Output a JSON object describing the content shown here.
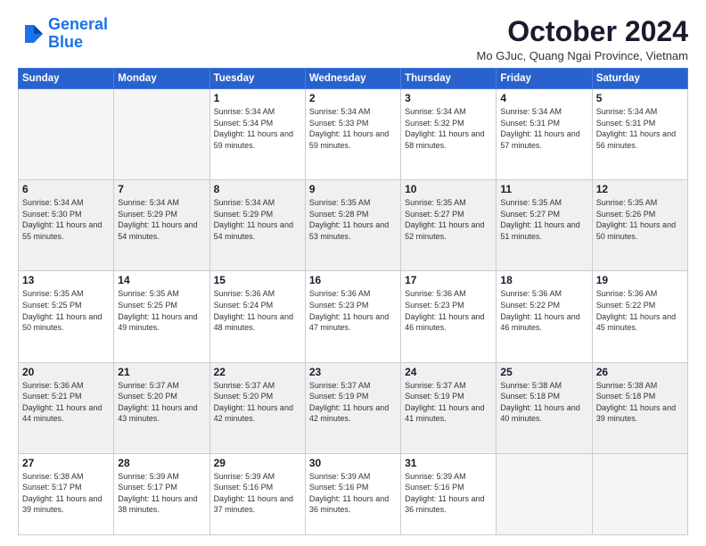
{
  "logo": {
    "line1": "General",
    "line2": "Blue"
  },
  "title": "October 2024",
  "location": "Mo GJuc, Quang Ngai Province, Vietnam",
  "days_of_week": [
    "Sunday",
    "Monday",
    "Tuesday",
    "Wednesday",
    "Thursday",
    "Friday",
    "Saturday"
  ],
  "weeks": [
    [
      {
        "num": "",
        "detail": ""
      },
      {
        "num": "",
        "detail": ""
      },
      {
        "num": "1",
        "detail": "Sunrise: 5:34 AM\nSunset: 5:34 PM\nDaylight: 11 hours and 59 minutes."
      },
      {
        "num": "2",
        "detail": "Sunrise: 5:34 AM\nSunset: 5:33 PM\nDaylight: 11 hours and 59 minutes."
      },
      {
        "num": "3",
        "detail": "Sunrise: 5:34 AM\nSunset: 5:32 PM\nDaylight: 11 hours and 58 minutes."
      },
      {
        "num": "4",
        "detail": "Sunrise: 5:34 AM\nSunset: 5:31 PM\nDaylight: 11 hours and 57 minutes."
      },
      {
        "num": "5",
        "detail": "Sunrise: 5:34 AM\nSunset: 5:31 PM\nDaylight: 11 hours and 56 minutes."
      }
    ],
    [
      {
        "num": "6",
        "detail": "Sunrise: 5:34 AM\nSunset: 5:30 PM\nDaylight: 11 hours and 55 minutes."
      },
      {
        "num": "7",
        "detail": "Sunrise: 5:34 AM\nSunset: 5:29 PM\nDaylight: 11 hours and 54 minutes."
      },
      {
        "num": "8",
        "detail": "Sunrise: 5:34 AM\nSunset: 5:29 PM\nDaylight: 11 hours and 54 minutes."
      },
      {
        "num": "9",
        "detail": "Sunrise: 5:35 AM\nSunset: 5:28 PM\nDaylight: 11 hours and 53 minutes."
      },
      {
        "num": "10",
        "detail": "Sunrise: 5:35 AM\nSunset: 5:27 PM\nDaylight: 11 hours and 52 minutes."
      },
      {
        "num": "11",
        "detail": "Sunrise: 5:35 AM\nSunset: 5:27 PM\nDaylight: 11 hours and 51 minutes."
      },
      {
        "num": "12",
        "detail": "Sunrise: 5:35 AM\nSunset: 5:26 PM\nDaylight: 11 hours and 50 minutes."
      }
    ],
    [
      {
        "num": "13",
        "detail": "Sunrise: 5:35 AM\nSunset: 5:25 PM\nDaylight: 11 hours and 50 minutes."
      },
      {
        "num": "14",
        "detail": "Sunrise: 5:35 AM\nSunset: 5:25 PM\nDaylight: 11 hours and 49 minutes."
      },
      {
        "num": "15",
        "detail": "Sunrise: 5:36 AM\nSunset: 5:24 PM\nDaylight: 11 hours and 48 minutes."
      },
      {
        "num": "16",
        "detail": "Sunrise: 5:36 AM\nSunset: 5:23 PM\nDaylight: 11 hours and 47 minutes."
      },
      {
        "num": "17",
        "detail": "Sunrise: 5:36 AM\nSunset: 5:23 PM\nDaylight: 11 hours and 46 minutes."
      },
      {
        "num": "18",
        "detail": "Sunrise: 5:36 AM\nSunset: 5:22 PM\nDaylight: 11 hours and 46 minutes."
      },
      {
        "num": "19",
        "detail": "Sunrise: 5:36 AM\nSunset: 5:22 PM\nDaylight: 11 hours and 45 minutes."
      }
    ],
    [
      {
        "num": "20",
        "detail": "Sunrise: 5:36 AM\nSunset: 5:21 PM\nDaylight: 11 hours and 44 minutes."
      },
      {
        "num": "21",
        "detail": "Sunrise: 5:37 AM\nSunset: 5:20 PM\nDaylight: 11 hours and 43 minutes."
      },
      {
        "num": "22",
        "detail": "Sunrise: 5:37 AM\nSunset: 5:20 PM\nDaylight: 11 hours and 42 minutes."
      },
      {
        "num": "23",
        "detail": "Sunrise: 5:37 AM\nSunset: 5:19 PM\nDaylight: 11 hours and 42 minutes."
      },
      {
        "num": "24",
        "detail": "Sunrise: 5:37 AM\nSunset: 5:19 PM\nDaylight: 11 hours and 41 minutes."
      },
      {
        "num": "25",
        "detail": "Sunrise: 5:38 AM\nSunset: 5:18 PM\nDaylight: 11 hours and 40 minutes."
      },
      {
        "num": "26",
        "detail": "Sunrise: 5:38 AM\nSunset: 5:18 PM\nDaylight: 11 hours and 39 minutes."
      }
    ],
    [
      {
        "num": "27",
        "detail": "Sunrise: 5:38 AM\nSunset: 5:17 PM\nDaylight: 11 hours and 39 minutes."
      },
      {
        "num": "28",
        "detail": "Sunrise: 5:39 AM\nSunset: 5:17 PM\nDaylight: 11 hours and 38 minutes."
      },
      {
        "num": "29",
        "detail": "Sunrise: 5:39 AM\nSunset: 5:16 PM\nDaylight: 11 hours and 37 minutes."
      },
      {
        "num": "30",
        "detail": "Sunrise: 5:39 AM\nSunset: 5:16 PM\nDaylight: 11 hours and 36 minutes."
      },
      {
        "num": "31",
        "detail": "Sunrise: 5:39 AM\nSunset: 5:16 PM\nDaylight: 11 hours and 36 minutes."
      },
      {
        "num": "",
        "detail": ""
      },
      {
        "num": "",
        "detail": ""
      }
    ]
  ]
}
